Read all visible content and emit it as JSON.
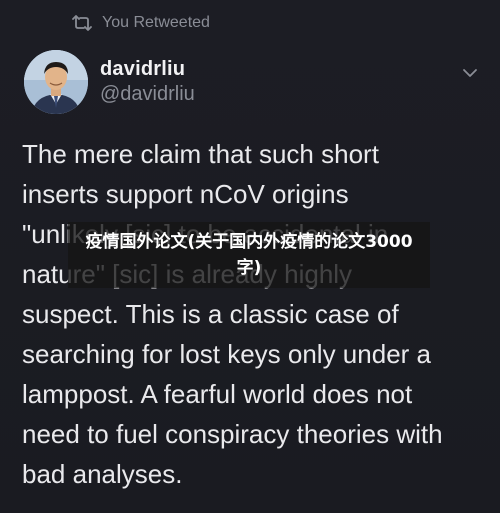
{
  "retweet": {
    "icon": "retweet-icon",
    "label": "You Retweeted"
  },
  "author": {
    "display_name": "davidrliu",
    "handle": "@davidrliu",
    "avatar_icon": "avatar"
  },
  "menu": {
    "icon": "chevron-down-icon"
  },
  "tweet": {
    "lines": [
      "The mere claim that such short",
      "inserts support nCoV origins",
      "\"unlikely [sic] to be accidental in",
      "nature\" [sic] is already highly",
      "suspect. This is a classic case of",
      "searching for lost keys only under a",
      "lamppost. A fearful world does not",
      "need to fuel conspiracy theories with",
      "bad analyses."
    ]
  },
  "overlay": {
    "text": "疫情国外论文(关于国内外疫情的论文3000字)"
  },
  "colors": {
    "background": "#1a1b22",
    "text_primary": "#e9e9ec",
    "text_secondary": "#8a8d96",
    "overlay_bg": "#141414"
  }
}
